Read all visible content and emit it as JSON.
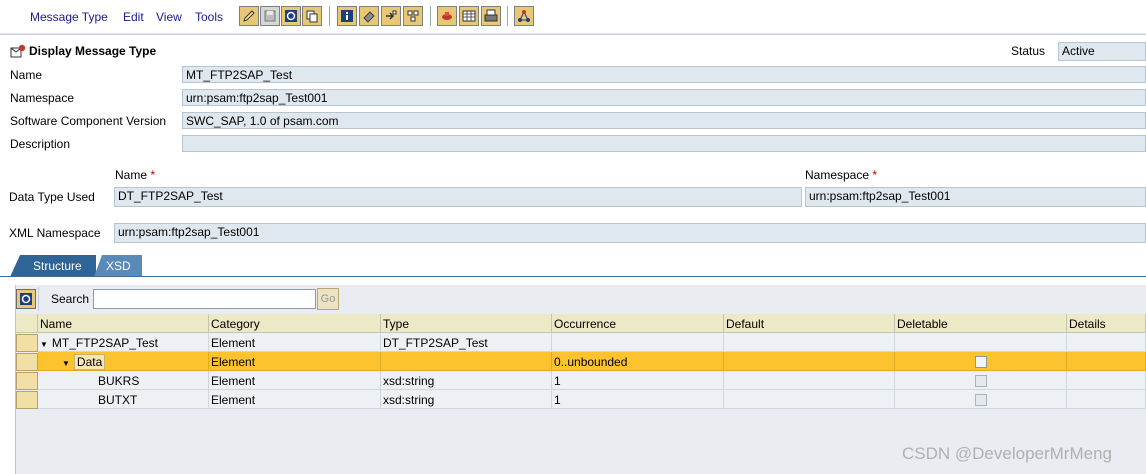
{
  "menus": [
    "Message Type",
    "Edit",
    "View",
    "Tools"
  ],
  "toolbar_icons": [
    "edit-pencil-icon",
    "save-icon",
    "refresh-icon",
    "copy-icon",
    "info-icon",
    "eraser-icon",
    "navigate-icon",
    "where-used-icon",
    "test-icon",
    "table-icon",
    "print-icon",
    "cluster-icon"
  ],
  "header": {
    "title": "Display Message Type",
    "status_label": "Status",
    "status_value": "Active"
  },
  "form": {
    "name_label": "Name",
    "name_value": "MT_FTP2SAP_Test",
    "namespace_label": "Namespace",
    "namespace_value": "urn:psam:ftp2sap_Test001",
    "swcv_label": "Software Component Version",
    "swcv_value": "SWC_SAP, 1.0 of psam.com",
    "description_label": "Description",
    "description_value": ""
  },
  "datatype": {
    "col_name": "Name",
    "col_namespace": "Namespace",
    "req_mark": "*",
    "label": "Data Type Used",
    "name_value": "DT_FTP2SAP_Test",
    "namespace_value": "urn:psam:ftp2sap_Test001"
  },
  "xml": {
    "label": "XML Namespace",
    "value": "urn:psam:ftp2sap_Test001"
  },
  "tabs": {
    "structure": "Structure",
    "xsd": "XSD"
  },
  "search": {
    "label": "Search",
    "value": "",
    "go": "Go"
  },
  "table": {
    "columns": [
      "Name",
      "Category",
      "Type",
      "Occurrence",
      "Default",
      "Deletable",
      "Details"
    ],
    "rows": [
      {
        "name": "MT_FTP2SAP_Test",
        "category": "Element",
        "type": "DT_FTP2SAP_Test",
        "occurrence": "",
        "default": "",
        "deletable": "none",
        "details": ""
      },
      {
        "name": "Data",
        "category": "Element",
        "type": "",
        "occurrence": "0..unbounded",
        "default": "",
        "deletable": "unchecked",
        "details": ""
      },
      {
        "name": "BUKRS",
        "category": "Element",
        "type": "xsd:string",
        "occurrence": "1",
        "default": "",
        "deletable": "unchecked",
        "details": ""
      },
      {
        "name": "BUTXT",
        "category": "Element",
        "type": "xsd:string",
        "occurrence": "1",
        "default": "",
        "deletable": "unchecked",
        "details": ""
      }
    ]
  },
  "watermark": "CSDN @DeveloperMrMeng",
  "colors": {
    "selected_row": "#fdc32f",
    "field_bg": "#dfe7ef",
    "tab_active": "#2f6496",
    "tab_inactive": "#5a8bb8",
    "header_bg": "#ece9c6"
  }
}
